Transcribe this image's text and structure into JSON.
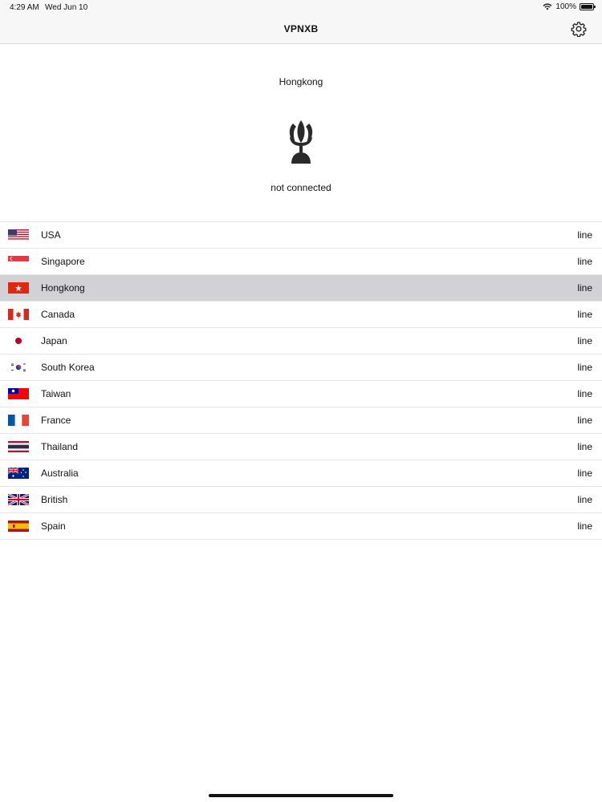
{
  "status_bar": {
    "time": "4:29 AM",
    "date": "Wed Jun 10",
    "battery": "100%"
  },
  "nav": {
    "title": "VPNXB",
    "settings_icon": "gear-icon"
  },
  "hero": {
    "location": "Hongkong",
    "status": "not connected",
    "icon": "lotus-connect-icon"
  },
  "servers": [
    {
      "name": "USA",
      "line": "line",
      "flag": "usa-flag-icon",
      "selected": false
    },
    {
      "name": "Singapore",
      "line": "line",
      "flag": "singapore-flag-icon",
      "selected": false
    },
    {
      "name": "Hongkong",
      "line": "line",
      "flag": "hongkong-flag-icon",
      "selected": true
    },
    {
      "name": "Canada",
      "line": "line",
      "flag": "canada-flag-icon",
      "selected": false
    },
    {
      "name": "Japan",
      "line": "line",
      "flag": "japan-flag-icon",
      "selected": false
    },
    {
      "name": "South Korea",
      "line": "line",
      "flag": "south-korea-flag-icon",
      "selected": false
    },
    {
      "name": "Taiwan",
      "line": "line",
      "flag": "taiwan-flag-icon",
      "selected": false
    },
    {
      "name": "France",
      "line": "line",
      "flag": "france-flag-icon",
      "selected": false
    },
    {
      "name": "Thailand",
      "line": "line",
      "flag": "thailand-flag-icon",
      "selected": false
    },
    {
      "name": "Australia",
      "line": "line",
      "flag": "australia-flag-icon",
      "selected": false
    },
    {
      "name": "British",
      "line": "line",
      "flag": "british-flag-icon",
      "selected": false
    },
    {
      "name": "Spain",
      "line": "line",
      "flag": "spain-flag-icon",
      "selected": false
    }
  ],
  "colors": {
    "selected_row": "#d1d1d6",
    "bar_background": "#f7f7f7"
  }
}
